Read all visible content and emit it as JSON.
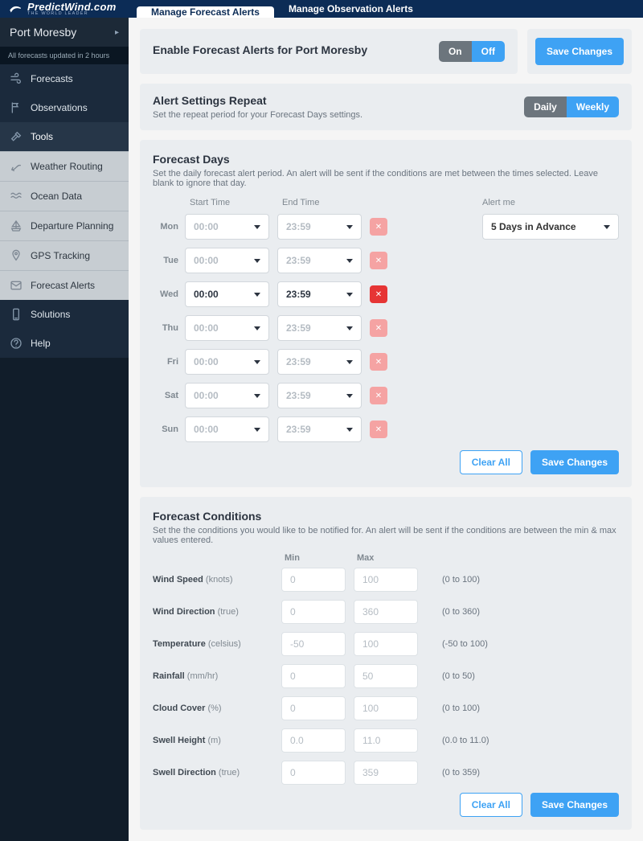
{
  "brand": {
    "name": "PredictWind.com",
    "tagline": "THE WORLD LEADER"
  },
  "tabs": [
    {
      "label": "Manage Forecast Alerts",
      "active": true
    },
    {
      "label": "Manage Observation Alerts",
      "active": false
    }
  ],
  "location": {
    "name": "Port Moresby",
    "updated": "All forecasts updated in 2 hours"
  },
  "sidebar": [
    {
      "label": "Forecasts",
      "icon": "wind-icon",
      "group": "dark"
    },
    {
      "label": "Observations",
      "icon": "flag-icon",
      "group": "dark"
    },
    {
      "label": "Tools",
      "icon": "hammer-icon",
      "group": "dark",
      "active": true
    },
    {
      "label": "Weather Routing",
      "icon": "route-icon",
      "group": "light"
    },
    {
      "label": "Ocean Data",
      "icon": "waves-icon",
      "group": "light"
    },
    {
      "label": "Departure Planning",
      "icon": "boat-icon",
      "group": "light"
    },
    {
      "label": "GPS Tracking",
      "icon": "pin-icon",
      "group": "light"
    },
    {
      "label": "Forecast Alerts",
      "icon": "mail-icon",
      "group": "light"
    },
    {
      "label": "Solutions",
      "icon": "phone-icon",
      "group": "dark"
    },
    {
      "label": "Help",
      "icon": "help-icon",
      "group": "dark"
    }
  ],
  "enable_panel": {
    "title": "Enable Forecast Alerts for Port Moresby",
    "on_label": "On",
    "off_label": "Off"
  },
  "save_button": "Save Changes",
  "repeat_panel": {
    "title": "Alert Settings Repeat",
    "sub": "Set the repeat period for your Forecast Days settings.",
    "daily": "Daily",
    "weekly": "Weekly"
  },
  "days_panel": {
    "title": "Forecast Days",
    "sub": "Set the daily forecast alert period. An alert will be sent if the conditions are met between the times selected. Leave blank to ignore that day.",
    "start_header": "Start Time",
    "end_header": "End Time",
    "alert_header": "Alert me",
    "alert_value": "5 Days in Advance",
    "clear_all": "Clear All",
    "save": "Save Changes",
    "days": [
      {
        "label": "Mon",
        "start": "00:00",
        "end": "23:59",
        "enabled": false
      },
      {
        "label": "Tue",
        "start": "00:00",
        "end": "23:59",
        "enabled": false
      },
      {
        "label": "Wed",
        "start": "00:00",
        "end": "23:59",
        "enabled": true
      },
      {
        "label": "Thu",
        "start": "00:00",
        "end": "23:59",
        "enabled": false
      },
      {
        "label": "Fri",
        "start": "00:00",
        "end": "23:59",
        "enabled": false
      },
      {
        "label": "Sat",
        "start": "00:00",
        "end": "23:59",
        "enabled": false
      },
      {
        "label": "Sun",
        "start": "00:00",
        "end": "23:59",
        "enabled": false
      }
    ]
  },
  "cond_panel": {
    "title": "Forecast Conditions",
    "sub": "Set the the conditions you would like to be notified for.  An alert will be sent if the conditions are between the min & max values entered.",
    "min_header": "Min",
    "max_header": "Max",
    "clear_all": "Clear All",
    "save": "Save Changes",
    "conditions": [
      {
        "name": "Wind Speed",
        "unit": "(knots)",
        "min_ph": "0",
        "max_ph": "100",
        "range": "(0 to 100)"
      },
      {
        "name": "Wind Direction",
        "unit": "(true)",
        "min_ph": "0",
        "max_ph": "360",
        "range": "(0 to 360)"
      },
      {
        "name": "Temperature",
        "unit": "(celsius)",
        "min_ph": "-50",
        "max_ph": "100",
        "range": "(-50 to 100)"
      },
      {
        "name": "Rainfall",
        "unit": "(mm/hr)",
        "min_ph": "0",
        "max_ph": "50",
        "range": "(0 to 50)"
      },
      {
        "name": "Cloud Cover",
        "unit": "(%)",
        "min_ph": "0",
        "max_ph": "100",
        "range": "(0 to 100)"
      },
      {
        "name": "Swell Height",
        "unit": "(m)",
        "min_ph": "0.0",
        "max_ph": "11.0",
        "range": "(0.0 to 11.0)"
      },
      {
        "name": "Swell Direction",
        "unit": "(true)",
        "min_ph": "0",
        "max_ph": "359",
        "range": "(0 to 359)"
      }
    ]
  }
}
